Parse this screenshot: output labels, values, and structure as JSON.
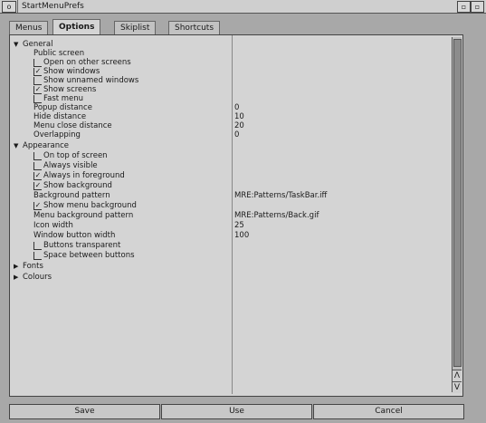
{
  "window": {
    "title": "StartMenuPrefs",
    "close_glyph": "o",
    "depth_glyph": "▫"
  },
  "tabs": [
    {
      "label": "Menus",
      "active": false
    },
    {
      "label": "Options",
      "active": true
    },
    {
      "label": "Skiplist",
      "active": false
    },
    {
      "label": "Shortcuts",
      "active": false
    }
  ],
  "tree": {
    "general": {
      "label": "General",
      "expanded": true
    },
    "public_screen": {
      "label": "Public screen"
    },
    "open_other": {
      "label": "Open on other screens",
      "checked": false
    },
    "show_windows": {
      "label": "Show windows",
      "checked": true
    },
    "show_unnamed": {
      "label": "Show unnamed windows",
      "checked": false
    },
    "show_screens": {
      "label": "Show screens",
      "checked": true
    },
    "fast_menu": {
      "label": "Fast menu",
      "checked": false
    },
    "popup_distance": {
      "label": "Popup distance",
      "value": "0"
    },
    "hide_distance": {
      "label": "Hide distance",
      "value": "10"
    },
    "menu_close_distance": {
      "label": "Menu close distance",
      "value": "20"
    },
    "overlapping": {
      "label": "Overlapping",
      "value": "0"
    },
    "appearance": {
      "label": "Appearance",
      "expanded": true
    },
    "on_top": {
      "label": "On top of screen",
      "checked": false
    },
    "always_visible": {
      "label": "Always visible",
      "checked": false
    },
    "always_foreground": {
      "label": "Always in foreground",
      "checked": true
    },
    "show_background": {
      "label": "Show background",
      "checked": true
    },
    "background_pattern": {
      "label": "Background pattern",
      "value": "MRE:Patterns/TaskBar.iff"
    },
    "show_menu_background": {
      "label": "Show menu background",
      "checked": true
    },
    "menu_background_pattern": {
      "label": "Menu background pattern",
      "value": "MRE:Patterns/Back.gif"
    },
    "icon_width": {
      "label": "Icon width",
      "value": "25"
    },
    "window_button_width": {
      "label": "Window button width",
      "value": "100"
    },
    "buttons_transparent": {
      "label": "Buttons transparent",
      "checked": false
    },
    "space_between_buttons": {
      "label": "Space between buttons",
      "checked": false
    },
    "fonts": {
      "label": "Fonts",
      "expanded": false
    },
    "colours": {
      "label": "Colours",
      "expanded": false
    }
  },
  "glyphs": {
    "expanded_arrow": "▼",
    "collapsed_arrow": "▶",
    "check": "✓",
    "scroll_up": "Λ",
    "scroll_down": "V"
  },
  "buttons": {
    "save": "Save",
    "use": "Use",
    "cancel": "Cancel"
  }
}
